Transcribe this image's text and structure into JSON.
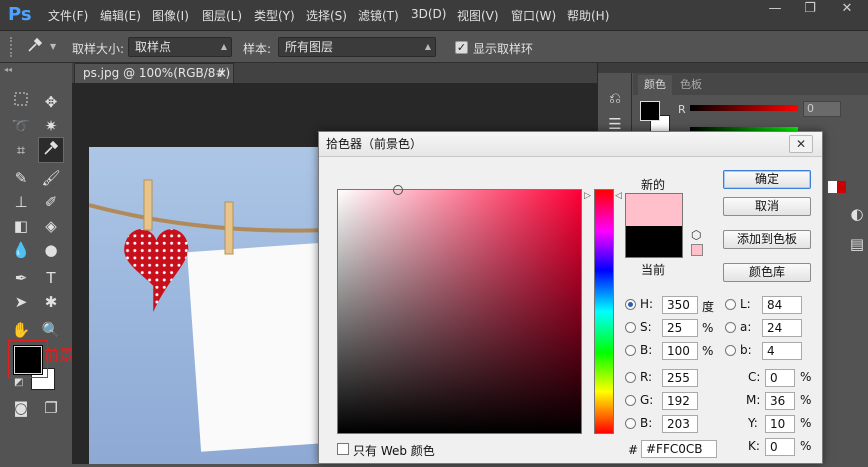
{
  "app": {
    "logo": "Ps"
  },
  "menu": [
    "文件(F)",
    "编辑(E)",
    "图像(I)",
    "图层(L)",
    "类型(Y)",
    "选择(S)",
    "滤镜(T)",
    "3D(D)",
    "视图(V)",
    "窗口(W)",
    "帮助(H)"
  ],
  "window_controls": {
    "minimize": "—",
    "restore": "❐",
    "close": "✕"
  },
  "options_bar": {
    "sample_size_label": "取样大小:",
    "sample_size_value": "取样点",
    "sample_label": "样本:",
    "sample_value": "所有图层",
    "show_ring_label": "显示取样环",
    "show_ring_checked": true
  },
  "document": {
    "tab_title": "ps.jpg @ 100%(RGB/8#) *",
    "tab_close": "×"
  },
  "annotation": {
    "foreground_label": "前景色"
  },
  "panels": {
    "tab_color": "颜色",
    "tab_swatches": "色板",
    "r_label": "R",
    "r_value": "0"
  },
  "dialog": {
    "title": "拾色器（前景色）",
    "close": "✕",
    "new_label": "新的",
    "current_label": "当前",
    "new_color": "#FFC0CB",
    "current_color": "#000000",
    "buttons": {
      "ok": "确定",
      "cancel": "取消",
      "add_swatch": "添加到色板",
      "color_libraries": "颜色库"
    },
    "hsb": [
      {
        "label": "H:",
        "value": "350",
        "unit": "度",
        "selected": true
      },
      {
        "label": "S:",
        "value": "25",
        "unit": "%",
        "selected": false
      },
      {
        "label": "B:",
        "value": "100",
        "unit": "%",
        "selected": false
      }
    ],
    "rgb": [
      {
        "label": "R:",
        "value": "255"
      },
      {
        "label": "G:",
        "value": "192"
      },
      {
        "label": "B:",
        "value": "203"
      }
    ],
    "lab": [
      {
        "label": "L:",
        "value": "84"
      },
      {
        "label": "a:",
        "value": "24"
      },
      {
        "label": "b:",
        "value": "4"
      }
    ],
    "cmyk": [
      {
        "label": "C:",
        "value": "0",
        "unit": "%"
      },
      {
        "label": "M:",
        "value": "36",
        "unit": "%"
      },
      {
        "label": "Y:",
        "value": "10",
        "unit": "%"
      },
      {
        "label": "K:",
        "value": "0",
        "unit": "%"
      }
    ],
    "hex_label": "#",
    "hex_value": "#FFC0CB",
    "web_only_label": "只有 Web 颜色",
    "web_only_checked": false,
    "hue_color": "#FF0036"
  },
  "colors": {
    "accent_annotation": "#e02020",
    "dialog_default_button": "#3b7dd8"
  }
}
